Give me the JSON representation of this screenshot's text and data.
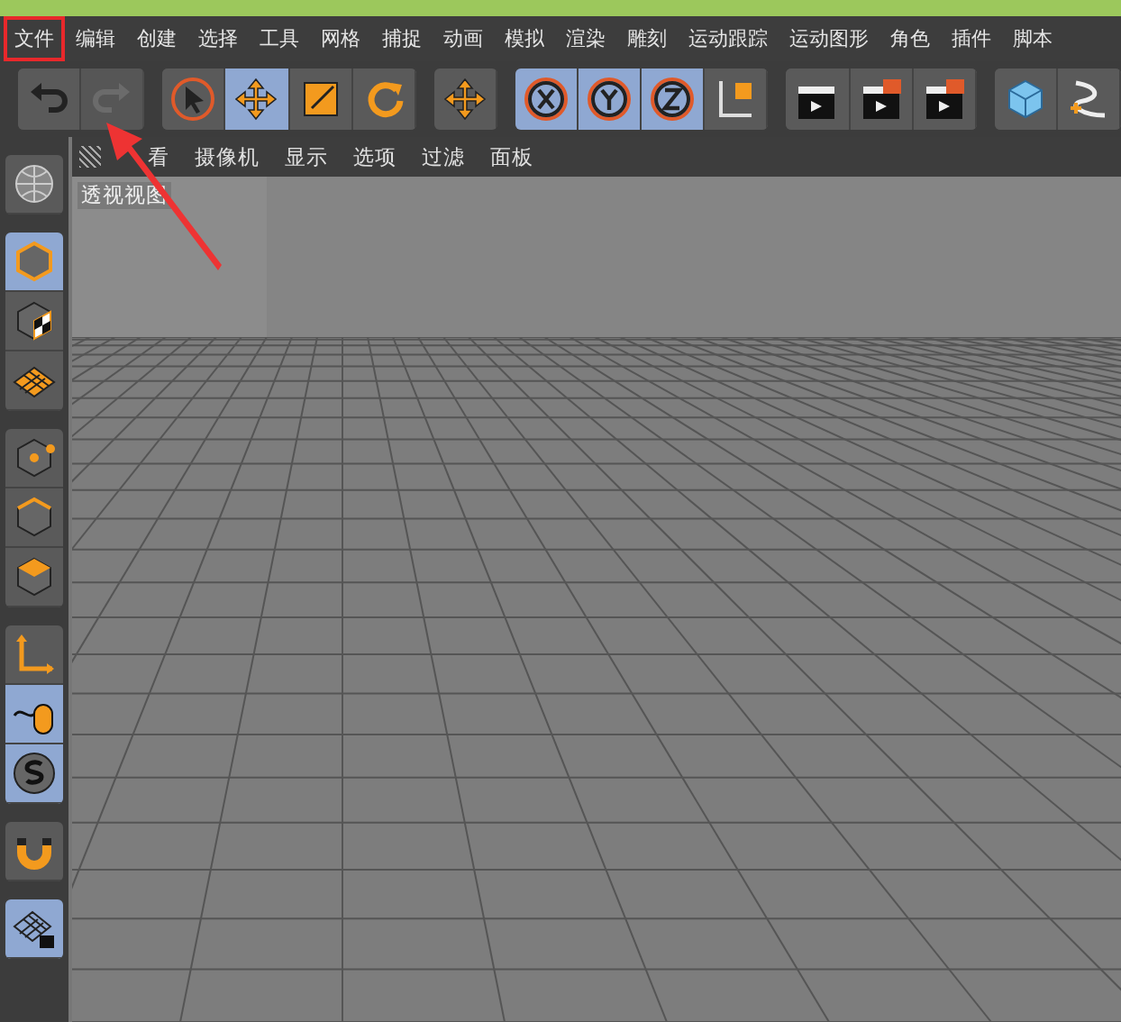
{
  "menu": [
    {
      "label": "文件",
      "highlighted": true
    },
    {
      "label": "编辑",
      "highlighted": false
    },
    {
      "label": "创建",
      "highlighted": false
    },
    {
      "label": "选择",
      "highlighted": false
    },
    {
      "label": "工具",
      "highlighted": false
    },
    {
      "label": "网格",
      "highlighted": false
    },
    {
      "label": "捕捉",
      "highlighted": false
    },
    {
      "label": "动画",
      "highlighted": false
    },
    {
      "label": "模拟",
      "highlighted": false
    },
    {
      "label": "渲染",
      "highlighted": false
    },
    {
      "label": "雕刻",
      "highlighted": false
    },
    {
      "label": "运动跟踪",
      "highlighted": false
    },
    {
      "label": "运动图形",
      "highlighted": false
    },
    {
      "label": "角色",
      "highlighted": false
    },
    {
      "label": "插件",
      "highlighted": false
    },
    {
      "label": "脚本",
      "highlighted": false
    }
  ],
  "toolbar": [
    {
      "buttons": [
        {
          "kind": "undo",
          "selected": false,
          "disabled": false
        },
        {
          "kind": "redo",
          "selected": false,
          "disabled": true
        }
      ]
    },
    {
      "buttons": [
        {
          "kind": "select",
          "selected": false,
          "disabled": false
        },
        {
          "kind": "move",
          "selected": true,
          "disabled": false
        },
        {
          "kind": "scale",
          "selected": false,
          "disabled": false
        },
        {
          "kind": "rotate",
          "selected": false,
          "disabled": false
        }
      ]
    },
    {
      "buttons": [
        {
          "kind": "move",
          "selected": false,
          "disabled": false
        }
      ]
    },
    {
      "buttons": [
        {
          "kind": "axis-x",
          "selected": true,
          "disabled": false
        },
        {
          "kind": "axis-y",
          "selected": true,
          "disabled": false
        },
        {
          "kind": "axis-z",
          "selected": true,
          "disabled": false
        },
        {
          "kind": "coords",
          "selected": false,
          "disabled": false
        }
      ]
    },
    {
      "buttons": [
        {
          "kind": "render-view",
          "selected": false,
          "disabled": false
        },
        {
          "kind": "render",
          "selected": false,
          "disabled": false
        },
        {
          "kind": "render-settings",
          "selected": false,
          "disabled": false
        }
      ]
    },
    {
      "buttons": [
        {
          "kind": "cube",
          "selected": false,
          "disabled": false
        },
        {
          "kind": "pen",
          "selected": false,
          "disabled": false
        }
      ]
    }
  ],
  "sidebar": [
    {
      "tools": [
        {
          "kind": "globe",
          "selected": false
        }
      ]
    },
    {
      "tools": [
        {
          "kind": "model",
          "selected": true
        },
        {
          "kind": "texture",
          "selected": false
        },
        {
          "kind": "workplane",
          "selected": false
        }
      ]
    },
    {
      "tools": [
        {
          "kind": "points",
          "selected": false
        },
        {
          "kind": "edges",
          "selected": false
        },
        {
          "kind": "polygons",
          "selected": false
        }
      ]
    },
    {
      "tools": [
        {
          "kind": "axis",
          "selected": false
        },
        {
          "kind": "tweak",
          "selected": true
        },
        {
          "kind": "snap",
          "selected": true
        }
      ]
    },
    {
      "tools": [
        {
          "kind": "magnet",
          "selected": false
        }
      ]
    },
    {
      "tools": [
        {
          "kind": "lock-grid",
          "selected": true
        }
      ]
    }
  ],
  "viewport": {
    "menu": [
      "看",
      "摄像机",
      "显示",
      "选项",
      "过滤",
      "面板"
    ],
    "title": "透视视图"
  }
}
